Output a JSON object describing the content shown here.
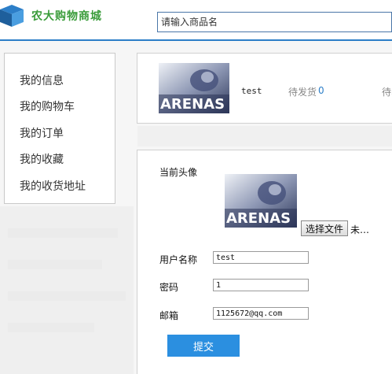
{
  "header": {
    "logo_text": "农大购物商城",
    "search_placeholder": "请输入商品名"
  },
  "sidebar": {
    "items": [
      {
        "label": "我的信息"
      },
      {
        "label": "我的购物车"
      },
      {
        "label": "我的订单"
      },
      {
        "label": "我的收藏"
      },
      {
        "label": "我的收货地址"
      }
    ]
  },
  "user_card": {
    "username": "test",
    "stats": [
      {
        "label": "待发货",
        "count": "0"
      },
      {
        "label": "待收货",
        "count": ""
      }
    ]
  },
  "profile_form": {
    "avatar_label": "当前头像",
    "avatar_image_text": "ARENAS",
    "choose_file_label": "选择文件",
    "file_status": "未…",
    "username_label": "用户名称",
    "username_value": "test",
    "password_label": "密码",
    "password_value": "1",
    "email_label": "邮箱",
    "email_value": "1125672@qq.com",
    "submit_label": "提交"
  },
  "colors": {
    "header_line": "#2c7ec8",
    "submit_button": "#2b8fe0",
    "logo_text": "#3a9c3a",
    "stat_count": "#2c7ec8"
  }
}
